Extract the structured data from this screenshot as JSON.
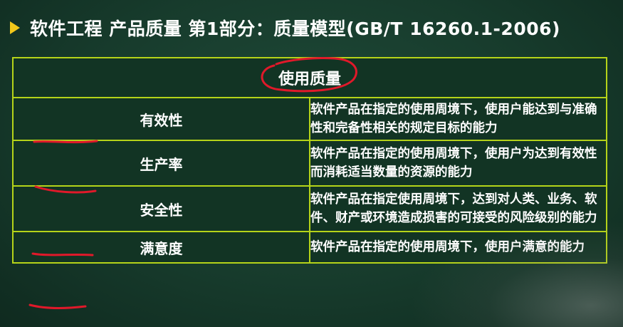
{
  "title": "软件工程 产品质量 第1部分：质量模型(GB/T 16260.1-2006)",
  "table": {
    "header": "使用质量",
    "rows": [
      {
        "term": "有效性",
        "description": "软件产品在指定的使用周境下，使用户能达到与准确性和完备性相关的规定目标的能力"
      },
      {
        "term": "生产率",
        "description": "软件产品在指定的使用周境下，使用户为达到有效性而消耗适当数量的资源的能力"
      },
      {
        "term": "安全性",
        "description": "软件产品在指定使用周境下，达到对人类、业务、软件、财产或环境造成损害的可接受的风险级别的能力"
      },
      {
        "term": "满意度",
        "description": "软件产品在指定的使用周境下，使用户满意的能力"
      }
    ]
  },
  "colors": {
    "background": "#173b2c",
    "border": "#b5d319",
    "bullet": "#f2c81a",
    "annotation": "#e0192a"
  }
}
